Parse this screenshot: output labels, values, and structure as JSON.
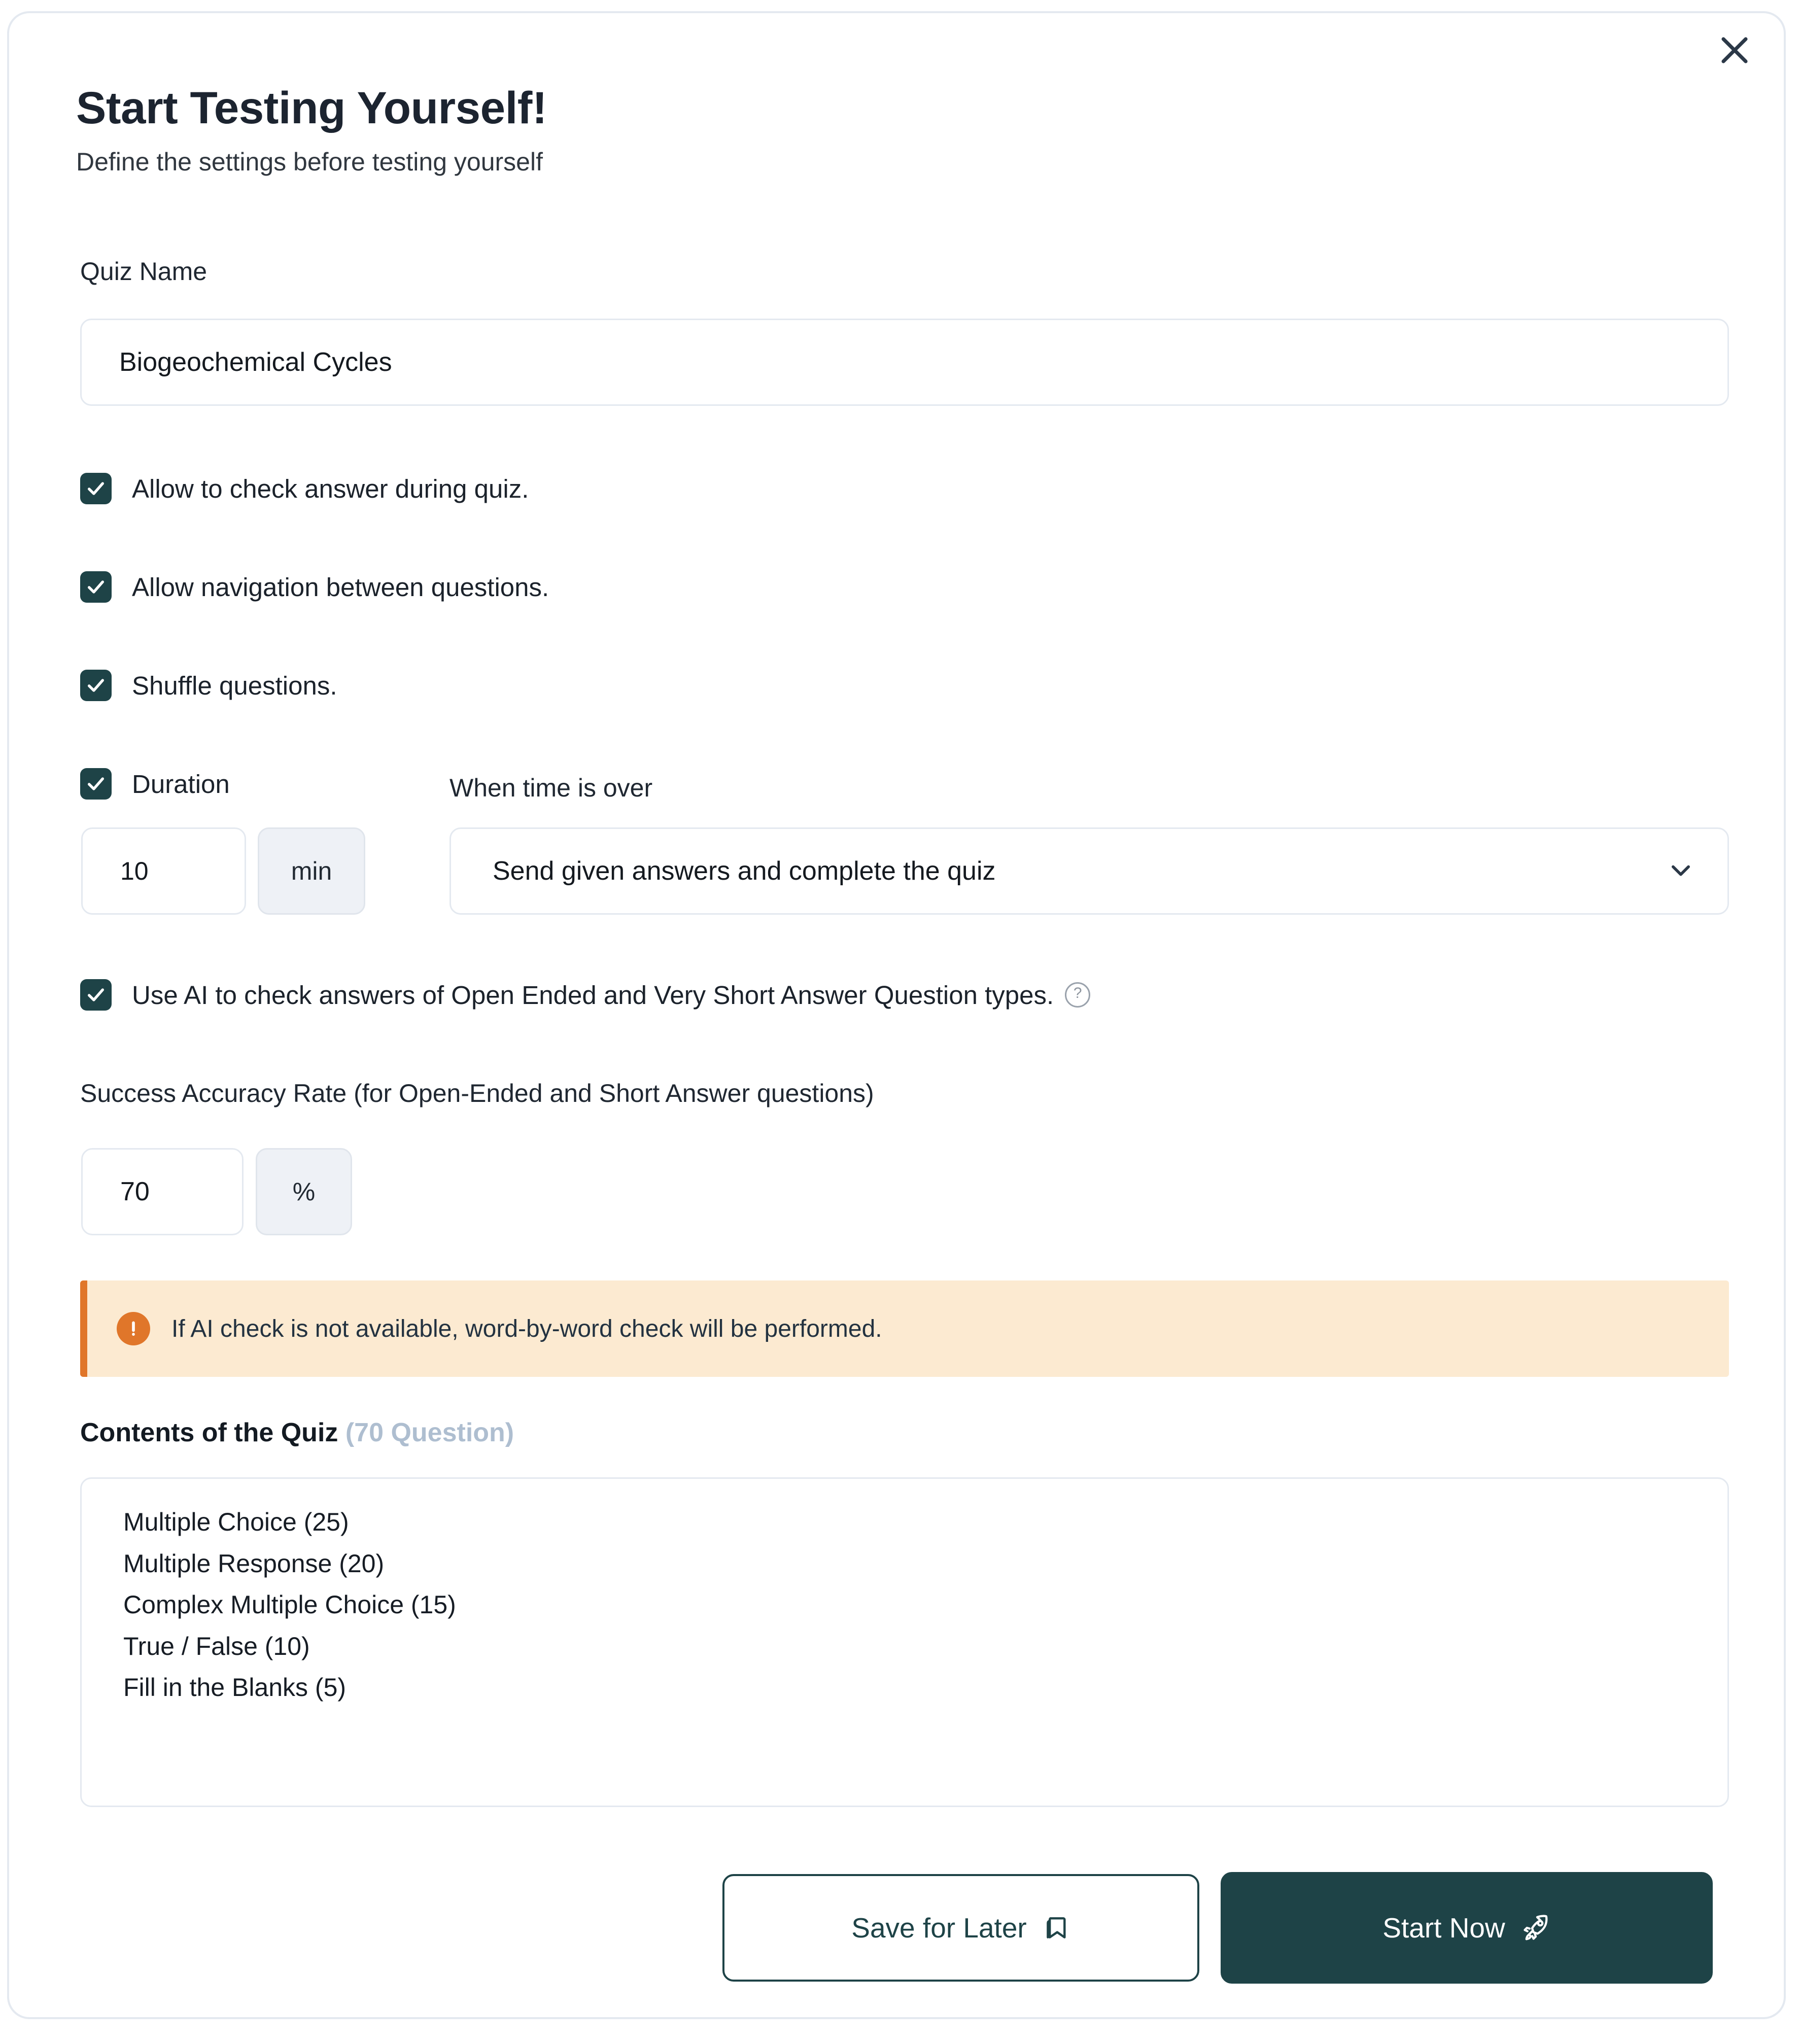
{
  "modal": {
    "title": "Start Testing Yourself!",
    "subtitle": "Define the settings before testing yourself",
    "close_icon": "close-icon"
  },
  "quiz_name": {
    "label": "Quiz Name",
    "value": "Biogeochemical Cycles",
    "placeholder": "Quiz Name"
  },
  "options": [
    {
      "label": "Allow to check answer during quiz.",
      "checked": true
    },
    {
      "label": "Allow navigation between questions.",
      "checked": true
    },
    {
      "label": "Shuffle questions.",
      "checked": true
    }
  ],
  "duration": {
    "label": "Duration",
    "checked": true,
    "value": "10",
    "unit": "min",
    "when_time_over_label": "When time is over",
    "when_time_over_value": "Send given answers and complete the quiz",
    "chevron_icon": "chevron-down-icon"
  },
  "ai_check": {
    "label": "Use AI to check answers of Open Ended and Very Short Answer Question types.",
    "checked": true,
    "help_icon": "help-circle-icon",
    "help_glyph": "?"
  },
  "accuracy": {
    "label": "Success Accuracy Rate (for Open-Ended and Short Answer questions)",
    "value": "70",
    "unit": "%"
  },
  "warning": {
    "icon": "alert-circle-icon",
    "text": "If AI check is not available, word-by-word check will be performed."
  },
  "contents": {
    "heading": "Contents of the Quiz",
    "count_label": "(70 Question)",
    "items": [
      "Multiple Choice (25)",
      "Multiple Response (20)",
      "Complex Multiple Choice (15)",
      "True / False (10)",
      "Fill in the Blanks (5)"
    ]
  },
  "footer": {
    "save_label": "Save for Later",
    "save_icon": "bookmark-icon",
    "start_label": "Start Now",
    "start_icon": "rocket-icon"
  },
  "colors": {
    "accent": "#1e4347",
    "warning_bar": "#e0762a",
    "warning_bg": "#fcead1",
    "border": "#e4e9f0",
    "muted_count": "#aebed0"
  }
}
